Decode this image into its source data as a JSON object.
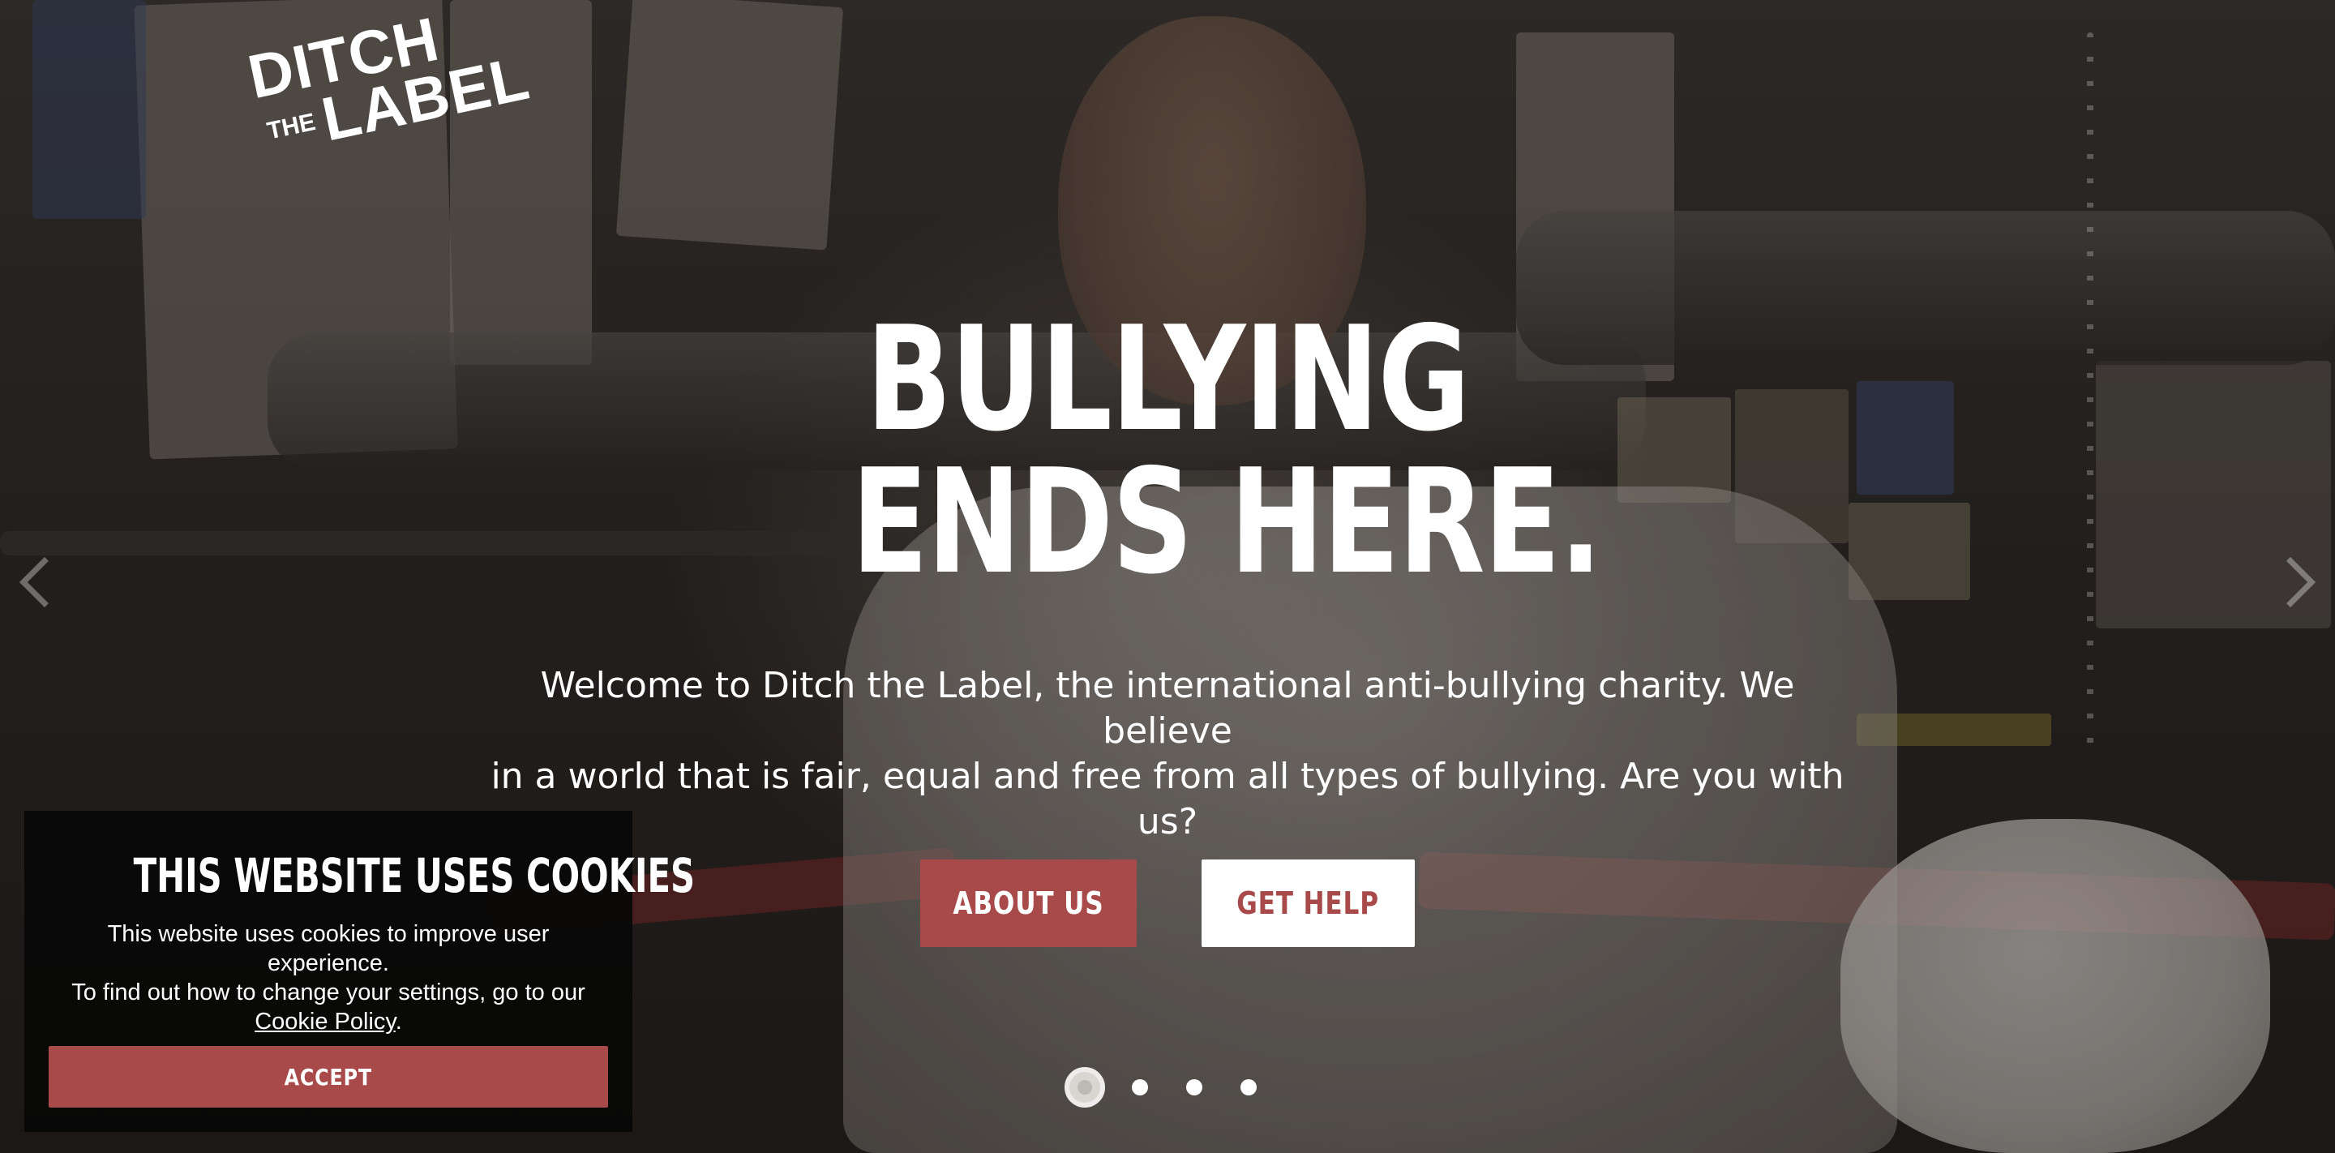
{
  "logo": {
    "line1": "DITCH",
    "line2": "THE",
    "line3": "LABEL"
  },
  "hero": {
    "headline_line1": "BULLYING",
    "headline_line2": "ENDS HERE.",
    "intro_line1": "Welcome to Ditch the Label, the international anti-bullying charity. We believe",
    "intro_line2": "in a world that is fair, equal and free from all types of bullying. Are you with us?",
    "buttons": {
      "about": "ABOUT US",
      "help": "GET HELP"
    }
  },
  "carousel": {
    "slide_count": 4,
    "active_slide": 1
  },
  "cookie_banner": {
    "title": "THIS WEBSITE USES COOKIES",
    "message_line1": "This website uses cookies to improve user experience.",
    "message_line2": "To find out how to change your settings, go to our",
    "policy_link": "Cookie Policy",
    "message_end": ".",
    "accept_label": "ACCEPT"
  },
  "colors": {
    "accent": "#a84a4a",
    "banner_bg": "#080808",
    "text": "#ffffff"
  }
}
